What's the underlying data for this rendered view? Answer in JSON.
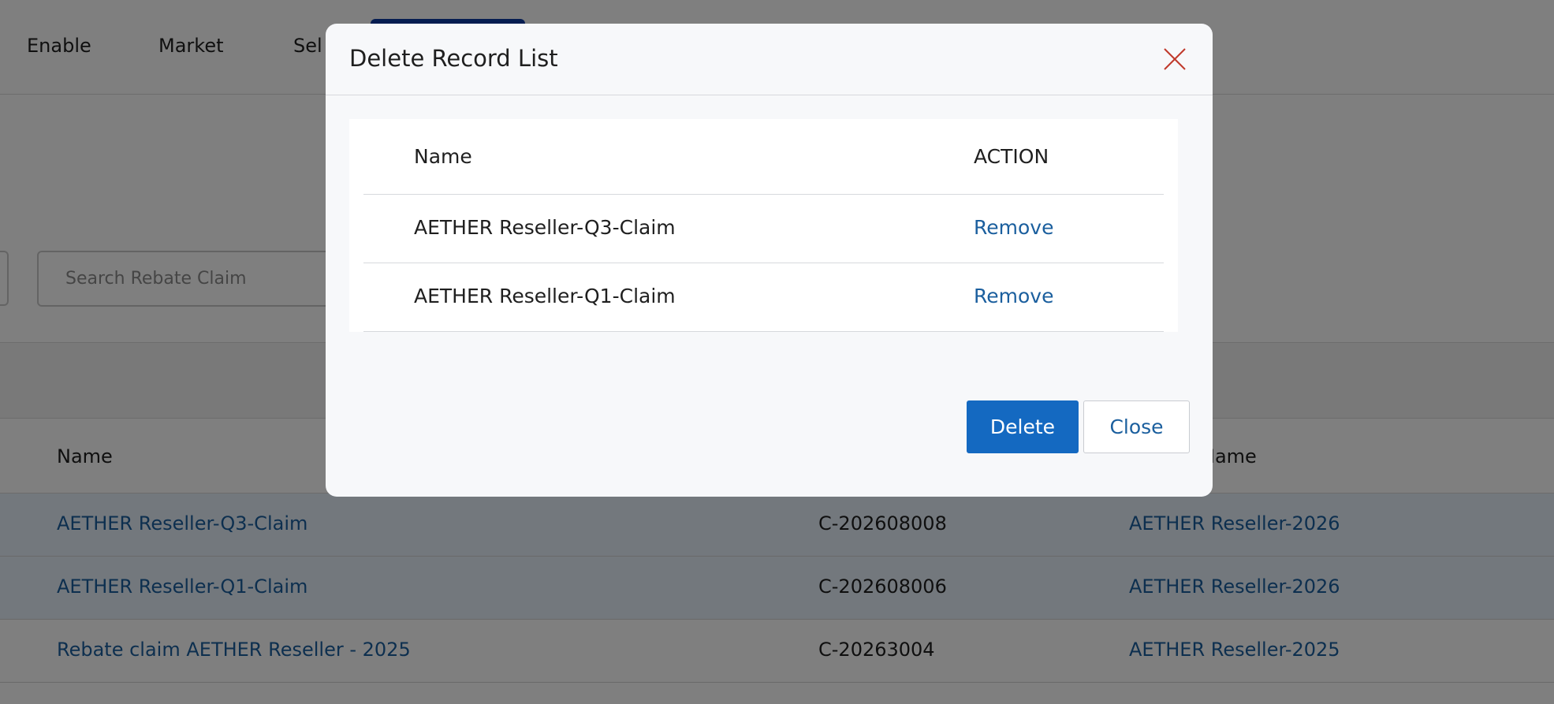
{
  "nav": {
    "items": [
      "Enable",
      "Market",
      "Sel"
    ]
  },
  "search": {
    "placeholder": "Search Rebate Claim"
  },
  "table": {
    "headers": [
      "Name",
      "Name"
    ],
    "rows": [
      {
        "name": "AETHER Reseller-Q3-Claim",
        "code": "C-202608008",
        "program": "AETHER Reseller-2026"
      },
      {
        "name": "AETHER Reseller-Q1-Claim",
        "code": "C-202608006",
        "program": "AETHER Reseller-2026"
      },
      {
        "name": "Rebate claim AETHER Reseller - 2025",
        "code": "C-20263004",
        "program": "AETHER Reseller-2025"
      }
    ]
  },
  "modal": {
    "title": "Delete Record List",
    "list": {
      "headers": {
        "name": "Name",
        "action": "ACTION"
      },
      "rows": [
        {
          "name": "AETHER Reseller-Q3-Claim",
          "action": "Remove"
        },
        {
          "name": "AETHER Reseller-Q1-Claim",
          "action": "Remove"
        }
      ]
    },
    "buttons": {
      "delete": "Delete",
      "close": "Close"
    }
  },
  "colors": {
    "primary": "#1469c1",
    "link": "#1b5f9e",
    "close_icon": "#c0392b",
    "overlay": "rgba(0,0,0,0.5)"
  },
  "icons": {
    "close": "close-icon"
  }
}
